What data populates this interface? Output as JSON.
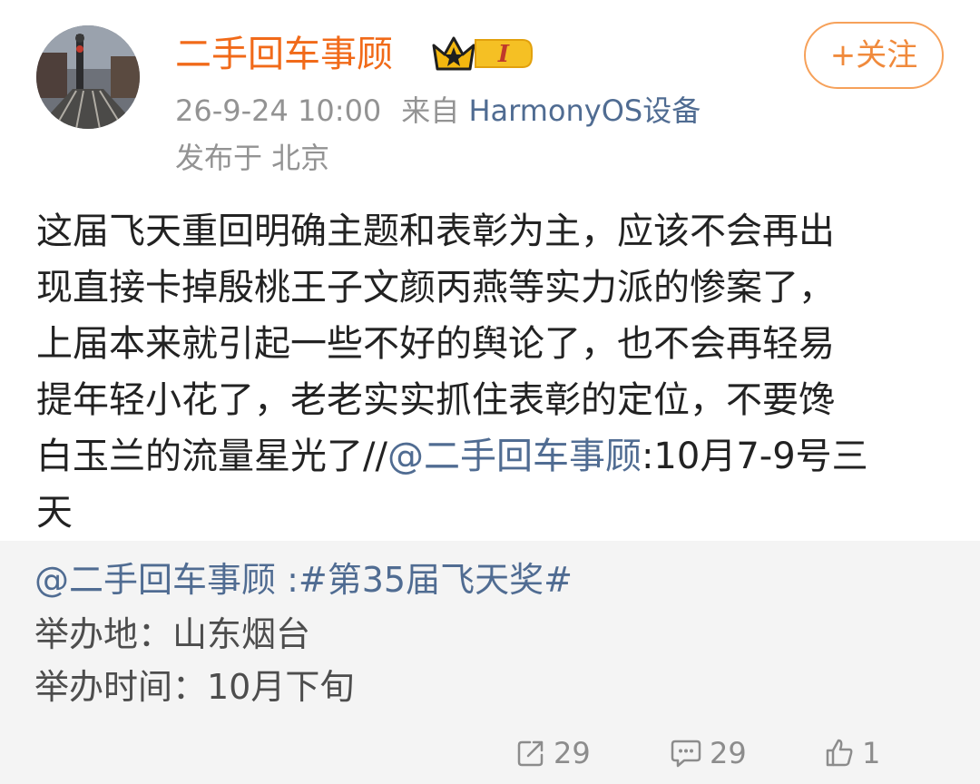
{
  "post": {
    "author": {
      "name": "二手回车事顾",
      "badge_level": "I"
    },
    "meta": {
      "time": "26-9-24 10:00",
      "source_prefix": "来自",
      "source_device": "HarmonyOS设备",
      "location": "发布于 北京"
    },
    "follow_label": "+关注",
    "body": {
      "line1": "这届飞天重回明确主题和表彰为主，应该不会再出",
      "line2": "现直接卡掉殷桃王子文颜丙燕等实力派的惨案了，",
      "line3": "上届本来就引起一些不好的舆论了，也不会再轻易",
      "line4": "提年轻小花了，老老实实抓住表彰的定位，不要馋",
      "line5_pre": "白玉兰的流量星光了//",
      "line5_mention": "@二手回车事顾",
      "line5_post": ":10月7-9号三",
      "line6": "天"
    },
    "quoted": {
      "mention": "@二手回车事顾 :#第35届飞天奖#",
      "line2": "举办地：山东烟台",
      "line3": "举办时间：10月下旬"
    },
    "actions": {
      "repost_count": "29",
      "comment_count": "29",
      "likes_partial": "1"
    },
    "colors": {
      "username": "#f16a19",
      "link": "#506c92",
      "follow_border": "#f6a15a",
      "meta_gray": "#939393",
      "quote_bg": "#f4f4f4"
    },
    "icons": [
      "avatar-photo",
      "crown-icon",
      "repost-icon",
      "comment-icon",
      "like-icon"
    ]
  }
}
